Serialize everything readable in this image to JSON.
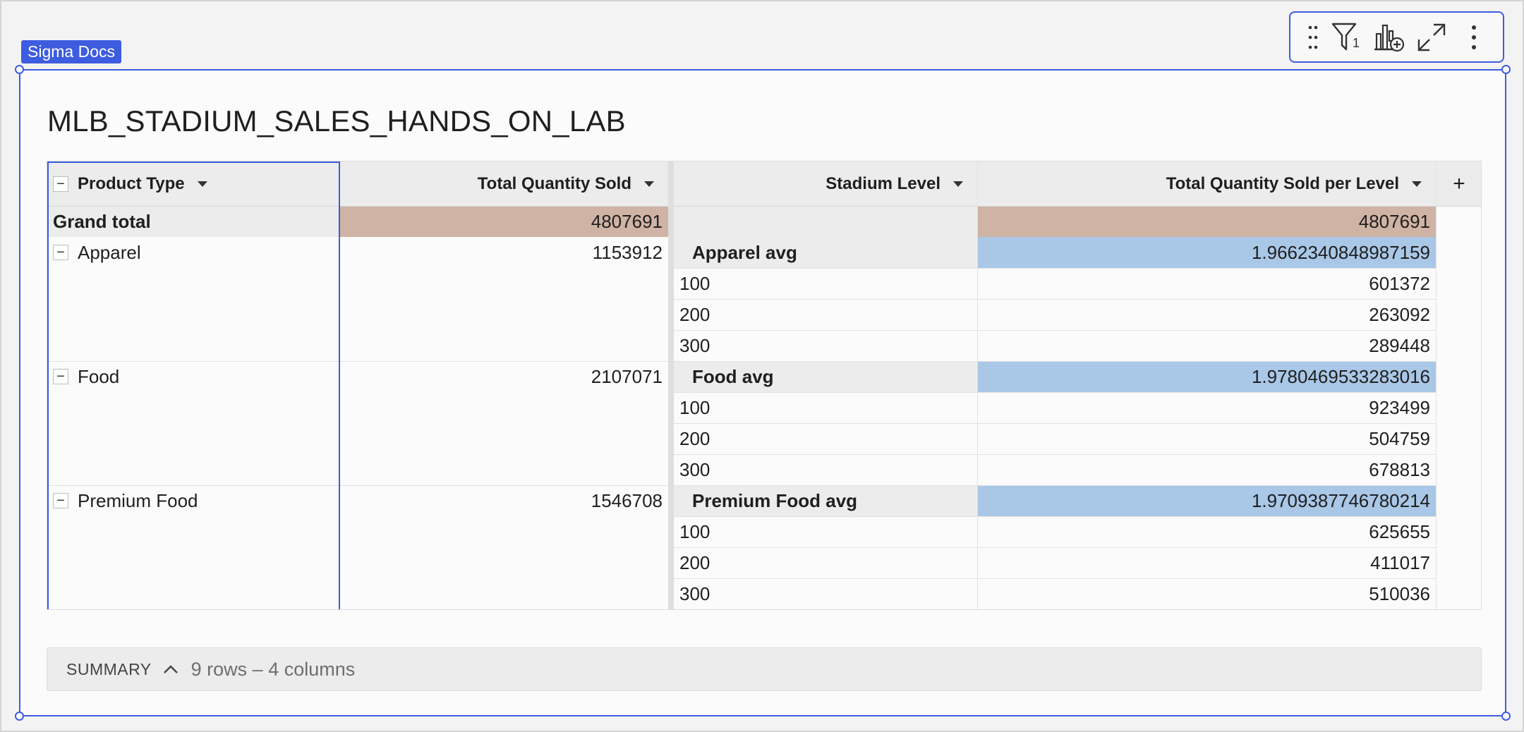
{
  "element_tag": "Sigma Docs",
  "toolbar": {
    "filter_count": "1"
  },
  "title": "MLB_STADIUM_SALES_HANDS_ON_LAB",
  "columns": {
    "product_type": "Product Type",
    "total_quantity_sold": "Total Quantity Sold",
    "stadium_level": "Stadium Level",
    "total_quantity_sold_per_level": "Total Quantity Sold per Level",
    "add": "+"
  },
  "grand_total": {
    "label": "Grand total",
    "total_quantity_sold": "4807691",
    "total_quantity_sold_per_level": "4807691"
  },
  "groups": [
    {
      "product_type": "Apparel",
      "collapse": "−",
      "total_quantity_sold": "1153912",
      "avg_label": "Apparel avg",
      "avg_value": "1.9662340848987159",
      "levels": [
        {
          "level": "100",
          "value": "601372"
        },
        {
          "level": "200",
          "value": "263092"
        },
        {
          "level": "300",
          "value": "289448"
        }
      ]
    },
    {
      "product_type": "Food",
      "collapse": "−",
      "total_quantity_sold": "2107071",
      "avg_label": "Food avg",
      "avg_value": "1.9780469533283016",
      "levels": [
        {
          "level": "100",
          "value": "923499"
        },
        {
          "level": "200",
          "value": "504759"
        },
        {
          "level": "300",
          "value": "678813"
        }
      ]
    },
    {
      "product_type": "Premium Food",
      "collapse": "−",
      "total_quantity_sold": "1546708",
      "avg_label": "Premium Food avg",
      "avg_value": "1.9709387746780214",
      "levels": [
        {
          "level": "100",
          "value": "625655"
        },
        {
          "level": "200",
          "value": "411017"
        },
        {
          "level": "300",
          "value": "510036"
        }
      ]
    }
  ],
  "header_collapse": "−",
  "summary": {
    "label": "SUMMARY",
    "count": "9 rows – 4 columns"
  },
  "colors": {
    "accent": "#3d5ce0",
    "grand_total_bg": "#cfb3a4",
    "avg_bg": "#a9c7e6",
    "subtotal_row_bg": "#ececec"
  }
}
